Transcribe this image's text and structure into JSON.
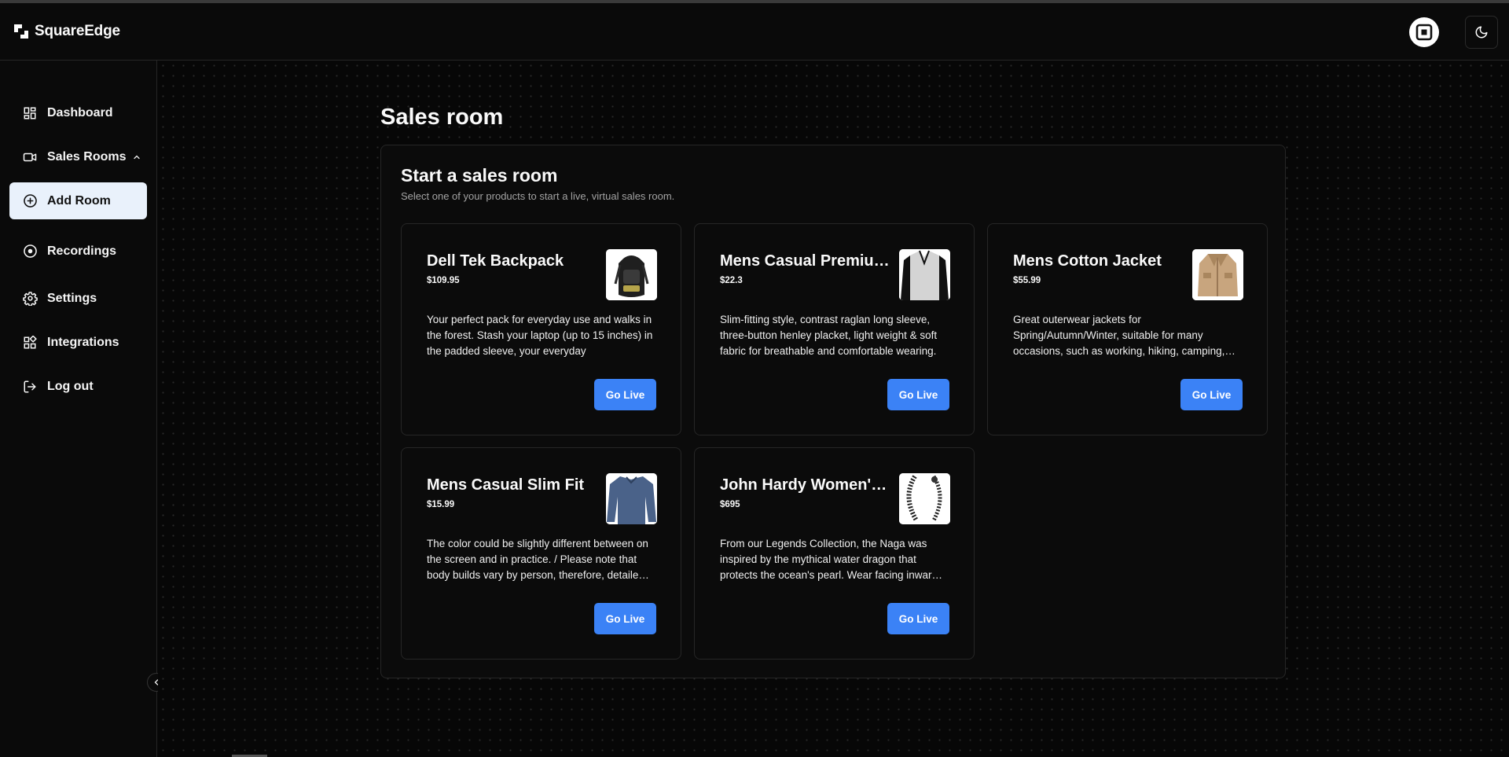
{
  "header": {
    "brand": "SquareEdge",
    "avatar_icon": "square-logo-icon",
    "theme_icon": "moon-icon"
  },
  "sidebar": {
    "items": [
      {
        "label": "Dashboard",
        "icon": "dashboard-icon"
      },
      {
        "label": "Sales Rooms",
        "icon": "video-camera-icon"
      },
      {
        "label": "Add Room",
        "icon": "plus-circle-icon"
      },
      {
        "label": "Recordings",
        "icon": "record-icon"
      },
      {
        "label": "Settings",
        "icon": "gear-icon"
      },
      {
        "label": "Integrations",
        "icon": "integrations-icon"
      },
      {
        "label": "Log out",
        "icon": "logout-icon"
      }
    ]
  },
  "main": {
    "title": "Sales room",
    "panel_title": "Start a sales room",
    "panel_subtitle": "Select one of your products to start a live, virtual sales room.",
    "products": [
      {
        "title": "Dell Tek Backpack",
        "price": "$109.95",
        "description": "Your perfect pack for everyday use and walks in the forest. Stash your laptop (up to 15 inches) in the padded sleeve, your everyday",
        "action": "Go Live",
        "thumb": "backpack"
      },
      {
        "title": "Mens Casual Premium Slim Fit T-Shirts",
        "price": "$22.3",
        "description": "Slim-fitting style, contrast raglan long sleeve, three-button henley placket, light weight & soft fabric for breathable and comfortable wearing.",
        "action": "Go Live",
        "thumb": "tshirt"
      },
      {
        "title": "Mens Cotton Jacket",
        "price": "$55.99",
        "description": "Great outerwear jackets for Spring/Autumn/Winter, suitable for many occasions, such as working, hiking, camping, mountain climbing.",
        "action": "Go Live",
        "thumb": "jacket"
      },
      {
        "title": "Mens Casual Slim Fit",
        "price": "$15.99",
        "description": "The color could be slightly different between on the screen and in practice. / Please note that body builds vary by person, therefore, detailed size information should be reviewed.",
        "action": "Go Live",
        "thumb": "longsleeve"
      },
      {
        "title": "John Hardy Women's Legends Naga Bracelet",
        "price": "$695",
        "description": "From our Legends Collection, the Naga was inspired by the mythical water dragon that protects the ocean's pearl. Wear facing inward to be bestowed with love.",
        "action": "Go Live",
        "thumb": "bracelet"
      }
    ]
  }
}
